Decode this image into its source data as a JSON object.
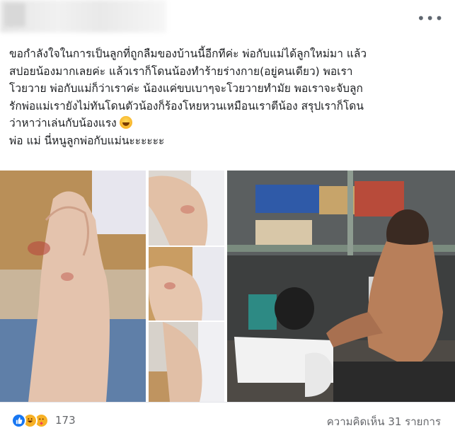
{
  "post": {
    "lines": [
      "ขอกำลังใจในการเป็นลูกที่ถูกลืมของบ้านนี้อีกทีค่ะ พ่อกับแม่ได้ลูกใหม่มา แล้ว",
      "สปอยน้องมากเลยค่ะ แล้วเราก็โดนน้องทำร้ายร่างกาย(อยู่คนเดียว) พอเรา",
      "โวยวาย พ่อกับแม่ก็ว่าเราค่ะ น้องแค่ขบเบาๆจะโวยวายทำมัย  พอเราจะจับลูก",
      "รักพ่อแม่เรายังไม่ทันโดนตัวน้องก็ร้องโหยหวนเหมือนเราตีน้อง สรุปเราก็โดน",
      "ว่าหาว่าเล่นกับน้องแรง",
      "พ่อ แม่ นี่หนูลูกพ่อกับแม่นะะะะะะ"
    ],
    "inline_emoji": "rofl-emoji"
  },
  "header": {
    "more_label": "•••"
  },
  "footer": {
    "reaction_count": "173",
    "comments_label": "ความคิดเห็น 31 รายการ",
    "reactions": [
      "like",
      "haha",
      "care"
    ]
  },
  "colors": {
    "like_blue": "#1877f2",
    "emoji_yellow": "#f7b125",
    "muted_text": "#65676b"
  }
}
